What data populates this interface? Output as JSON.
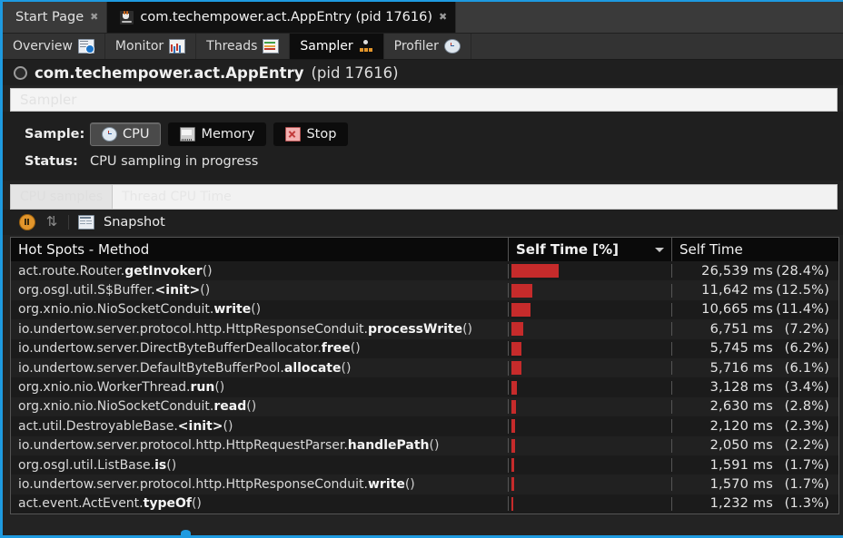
{
  "window": {
    "accent_color": "#1e9ae0",
    "bar_color": "#c62b2b"
  },
  "doc_tabs": [
    {
      "label": "Start Page",
      "icon": "",
      "active": false,
      "close": "✖"
    },
    {
      "label": "com.techempower.act.AppEntry (pid 17616)",
      "icon": "java-icon",
      "active": true,
      "close": "✖"
    }
  ],
  "view_tabs": [
    {
      "label": "Overview",
      "icon": "overview-icon",
      "active": false
    },
    {
      "label": "Monitor",
      "icon": "monitor-icon",
      "active": false
    },
    {
      "label": "Threads",
      "icon": "threads-icon",
      "active": false
    },
    {
      "label": "Sampler",
      "icon": "sampler-icon",
      "active": true
    },
    {
      "label": "Profiler",
      "icon": "profiler-icon",
      "active": false
    }
  ],
  "app_header": {
    "icon": "process-circle-icon",
    "name": "com.techempower.act.AppEntry",
    "pid": "(pid 17616)"
  },
  "ghost_strip": {
    "label": "Sampler"
  },
  "sample": {
    "label": "Sample:",
    "buttons": [
      {
        "label": "CPU",
        "icon": "cpu-clock-icon",
        "selected": true
      },
      {
        "label": "Memory",
        "icon": "memory-icon",
        "selected": false
      },
      {
        "label": "Stop",
        "icon": "stop-x-icon",
        "selected": false
      }
    ]
  },
  "status": {
    "label": "Status:",
    "value": "CPU sampling in progress"
  },
  "sub_tabs": [
    {
      "label": "CPU samples",
      "selected": true
    },
    {
      "label": "Thread CPU Time",
      "selected": false
    }
  ],
  "snapshot_toolbar": {
    "pause_icon": "pause-icon",
    "refresh_icon": "refresh-icon",
    "snapshot_icon": "snapshot-icon",
    "snapshot_label": "Snapshot"
  },
  "table": {
    "columns": [
      {
        "key": "method",
        "label": "Hot Spots - Method",
        "sorted": false
      },
      {
        "key": "self_pct_bar",
        "label": "Self Time [%]",
        "sorted": true,
        "sort_dir": "desc"
      },
      {
        "key": "self_time",
        "label": "Self Time",
        "sorted": false
      }
    ],
    "rows": [
      {
        "pkg": "act.route.Router.",
        "method": "getInvoker",
        "paren": "()",
        "pct": 28.4,
        "ms": "26,539 ms",
        "pct_text": "(28.4%)"
      },
      {
        "pkg": "org.osgl.util.S$Buffer.",
        "method": "<init>",
        "paren": "()",
        "pct": 12.5,
        "ms": "11,642 ms",
        "pct_text": "(12.5%)"
      },
      {
        "pkg": "org.xnio.nio.NioSocketConduit.",
        "method": "write",
        "paren": "()",
        "pct": 11.4,
        "ms": "10,665 ms",
        "pct_text": "(11.4%)"
      },
      {
        "pkg": "io.undertow.server.protocol.http.HttpResponseConduit.",
        "method": "processWrite",
        "paren": "()",
        "pct": 7.2,
        "ms": "6,751 ms",
        "pct_text": "(7.2%)"
      },
      {
        "pkg": "io.undertow.server.DirectByteBufferDeallocator.",
        "method": "free",
        "paren": "()",
        "pct": 6.2,
        "ms": "5,745 ms",
        "pct_text": "(6.2%)"
      },
      {
        "pkg": "io.undertow.server.DefaultByteBufferPool.",
        "method": "allocate",
        "paren": "()",
        "pct": 6.1,
        "ms": "5,716 ms",
        "pct_text": "(6.1%)"
      },
      {
        "pkg": "org.xnio.nio.WorkerThread.",
        "method": "run",
        "paren": "()",
        "pct": 3.4,
        "ms": "3,128 ms",
        "pct_text": "(3.4%)"
      },
      {
        "pkg": "org.xnio.nio.NioSocketConduit.",
        "method": "read",
        "paren": "()",
        "pct": 2.8,
        "ms": "2,630 ms",
        "pct_text": "(2.8%)"
      },
      {
        "pkg": "act.util.DestroyableBase.",
        "method": "<init>",
        "paren": "()",
        "pct": 2.3,
        "ms": "2,120 ms",
        "pct_text": "(2.3%)"
      },
      {
        "pkg": "io.undertow.server.protocol.http.HttpRequestParser.",
        "method": "handlePath",
        "paren": "()",
        "pct": 2.2,
        "ms": "2,050 ms",
        "pct_text": "(2.2%)"
      },
      {
        "pkg": "org.osgl.util.ListBase.",
        "method": "is",
        "paren": "()",
        "pct": 1.7,
        "ms": "1,591 ms",
        "pct_text": "(1.7%)"
      },
      {
        "pkg": "io.undertow.server.protocol.http.HttpResponseConduit.",
        "method": "write",
        "paren": "()",
        "pct": 1.7,
        "ms": "1,570 ms",
        "pct_text": "(1.7%)"
      },
      {
        "pkg": "act.event.ActEvent.",
        "method": "typeOf",
        "paren": "()",
        "pct": 1.3,
        "ms": "1,232 ms",
        "pct_text": "(1.3%)"
      }
    ]
  }
}
